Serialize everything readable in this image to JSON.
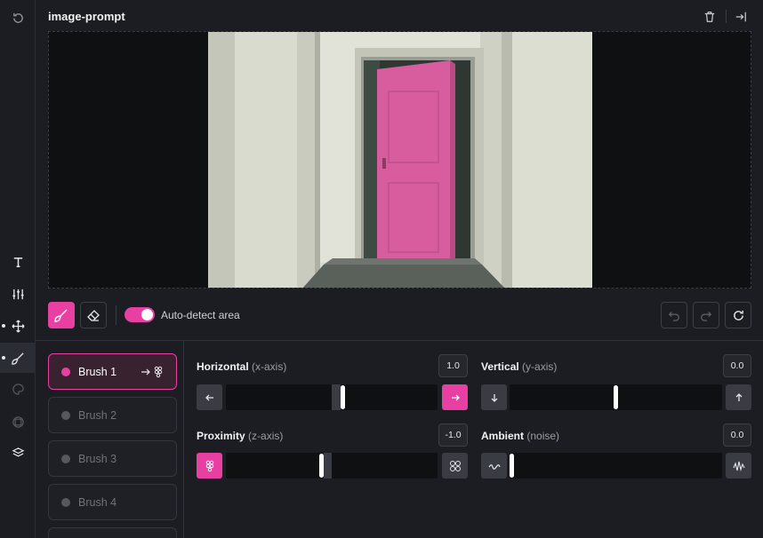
{
  "header": {
    "title": "image-prompt"
  },
  "rail": {
    "items": [
      {
        "icon": "history-icon"
      },
      {
        "icon": "text-icon"
      },
      {
        "icon": "adjustments-icon"
      },
      {
        "icon": "move-icon",
        "dot": true
      },
      {
        "icon": "brush-icon",
        "dot": true,
        "active": true
      },
      {
        "icon": "palette-icon"
      },
      {
        "icon": "frame-icon"
      },
      {
        "icon": "layers-icon"
      }
    ]
  },
  "toolbar": {
    "auto_detect_label": "Auto-detect area",
    "auto_detect_on": true
  },
  "brushes": [
    {
      "label": "Brush 1",
      "active": true
    },
    {
      "label": "Brush 2",
      "active": false
    },
    {
      "label": "Brush 3",
      "active": false
    },
    {
      "label": "Brush 4",
      "active": false
    }
  ],
  "sliders": {
    "horizontal": {
      "label": "Horizontal",
      "sub": "(x-axis)",
      "value": "1.0"
    },
    "vertical": {
      "label": "Vertical",
      "sub": "(y-axis)",
      "value": "0.0"
    },
    "proximity": {
      "label": "Proximity",
      "sub": "(z-axis)",
      "value": "-1.0"
    },
    "ambient": {
      "label": "Ambient",
      "sub": "(noise)",
      "value": "0.0"
    }
  },
  "colors": {
    "accent": "#e83fa3",
    "door": "#d85d9e"
  }
}
